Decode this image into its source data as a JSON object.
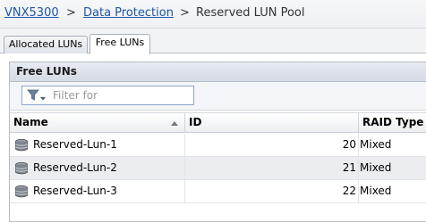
{
  "breadcrumb": {
    "items": [
      "VNX5300",
      "Data Protection",
      "Reserved LUN Pool"
    ],
    "separator": ">"
  },
  "tabs": [
    {
      "label": "Allocated LUNs",
      "active": false
    },
    {
      "label": "Free LUNs",
      "active": true
    }
  ],
  "panel": {
    "title": "Free LUNs",
    "filter": {
      "placeholder": "Filter for",
      "value": ""
    }
  },
  "table": {
    "columns": [
      "Name",
      "ID",
      "RAID Type"
    ],
    "sorted_column": "Name",
    "rows": [
      {
        "name": "Reserved-Lun-1",
        "id": "20",
        "raid": "Mixed",
        "icon": "lun-disk-icon"
      },
      {
        "name": "Reserved-Lun-2",
        "id": "21",
        "raid": "Mixed",
        "icon": "lun-disk-icon"
      },
      {
        "name": "Reserved-Lun-3",
        "id": "22",
        "raid": "Mixed",
        "icon": "lun-disk-icon"
      }
    ]
  },
  "colors": {
    "link": "#1f57a4",
    "alt_row": "#ebedf0",
    "panel_header": "#d5dbe4"
  }
}
